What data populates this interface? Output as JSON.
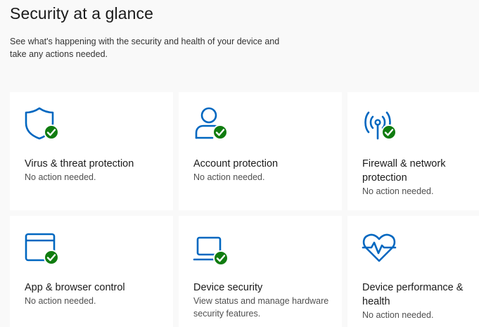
{
  "header": {
    "title": "Security at a glance",
    "subtitle": "See what's happening with the security and health of your device and take any actions needed."
  },
  "colors": {
    "icon_blue": "#0067c0",
    "check_green": "#107c10",
    "card_bg": "#ffffff",
    "page_bg": "#f9f9f9"
  },
  "cards": [
    {
      "icon": "shield-icon",
      "title": "Virus & threat protection",
      "status": "No action needed."
    },
    {
      "icon": "person-icon",
      "title": "Account protection",
      "status": "No action needed."
    },
    {
      "icon": "antenna-icon",
      "title": "Firewall & network protection",
      "status": "No action needed."
    },
    {
      "icon": "browser-window-icon",
      "title": "App & browser control",
      "status": "No action needed."
    },
    {
      "icon": "laptop-icon",
      "title": "Device security",
      "status": "View status and manage hardware security features."
    },
    {
      "icon": "heart-pulse-icon",
      "title": "Device performance & health",
      "status": "No action needed."
    }
  ]
}
